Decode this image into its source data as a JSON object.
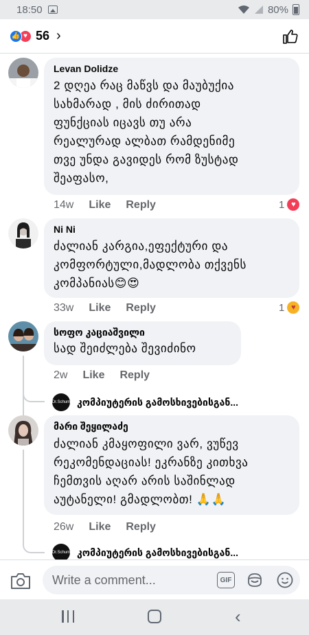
{
  "status_bar": {
    "time": "18:50",
    "battery": "80%"
  },
  "header": {
    "reaction_count": "56"
  },
  "comments": [
    {
      "author": "Levan Dolidze",
      "text": "2 დღეა რაც მაწვს და მაუბუქია\nსახმარად ,   მის ძირითად\nფუნქციას იცავს თუ არა\nრეალურად ალბათ რამდენიმე\nთვე უნდა გავიდეს რომ ზუსტად\nშეაფასო,",
      "time": "14w",
      "like": "Like",
      "reply": "Reply",
      "reaction_count": "1"
    },
    {
      "author": "Ni Ni",
      "text": "ძალიან კარგია,ეფექტური და\nკომფორტული,მადლობა თქვენს\nკომპანიას😊😍",
      "time": "33w",
      "like": "Like",
      "reply": "Reply",
      "reaction_count": "1"
    },
    {
      "author": "სოფო კაციაშვილი",
      "text": "სად  შეიძლება შევიძინო",
      "time": "2w",
      "like": "Like",
      "reply": "Reply",
      "reply_preview": {
        "avatar_text": "Dr.Schum",
        "name": "კომპიუტერის გამოსხივებისგან..."
      }
    },
    {
      "author": "მარი შეყილაძე",
      "text": "ძალიან კმაყოფილი ვარ, ვუწევ\nრეკომენდაციას! ეკრანზე კითხვა\nჩემთვის აღარ არის საშინლად\nაუტანელი! გმადლობთ! 🙏🙏",
      "time": "26w",
      "like": "Like",
      "reply": "Reply",
      "reply_preview": {
        "avatar_text": "Dr.Schum",
        "name": "კომპიუტერის გამოსხივებისგან..."
      }
    }
  ],
  "composer": {
    "placeholder": "Write a comment...",
    "gif_label": "GIF"
  }
}
